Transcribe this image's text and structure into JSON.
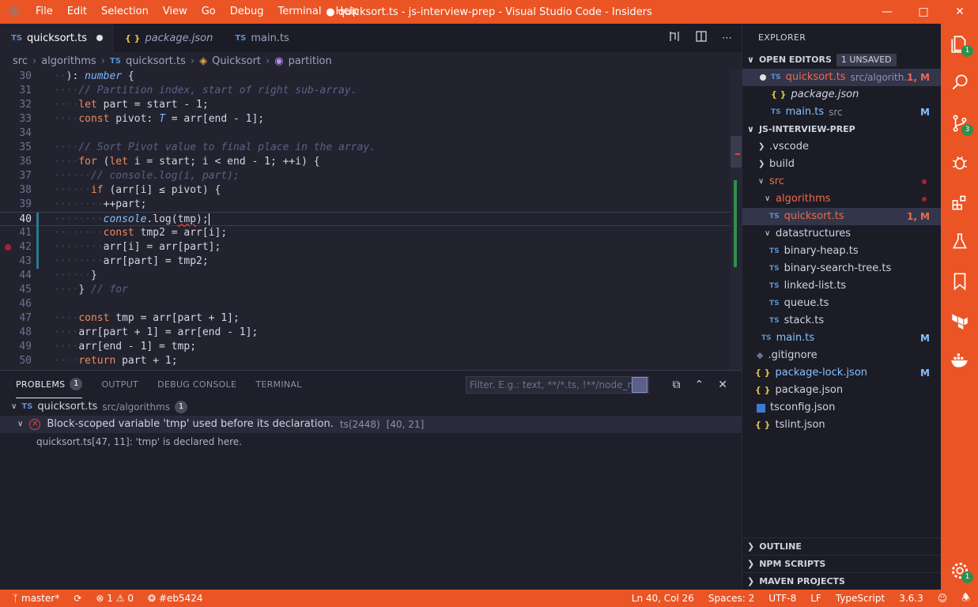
{
  "window": {
    "title": "● quicksort.ts - js-interview-prep - Visual Studio Code - Insiders",
    "menu": [
      "File",
      "Edit",
      "Selection",
      "View",
      "Go",
      "Debug",
      "Terminal",
      "Help"
    ],
    "logo": "⚛"
  },
  "tabs": [
    {
      "icon": "TS",
      "label": "quicksort.ts"
    },
    {
      "icon": "{ }",
      "label": "package.json"
    },
    {
      "icon": "TS",
      "label": "main.ts"
    }
  ],
  "breadcrumb": {
    "items": [
      "src",
      "algorithms",
      "quicksort.ts",
      "Quicksort",
      "partition"
    ]
  },
  "code": {
    "line_numbers": [
      "30",
      "31",
      "32",
      "33",
      "34",
      "35",
      "36",
      "37",
      "38",
      "39",
      "40",
      "41",
      "42",
      "43",
      "44",
      "45",
      "46",
      "47",
      "48",
      "49",
      "50"
    ],
    "lines": {
      "l30a": "): ",
      "l30b": "number",
      "l30c": " {",
      "l31": "// Partition index, start of right sub-array.",
      "l32a": "let",
      "l32b": " part = start - 1;",
      "l33a": "const",
      "l33b": " pivot: ",
      "l33c": "T",
      "l33d": " = arr[end - 1];",
      "l35": "// Sort Pivot value to final place in the array.",
      "l36a": "for",
      "l36b": " (",
      "l36c": "let",
      "l36d": " i = start; i < end - 1; ++i) {",
      "l37": "// console.log(i, part);",
      "l38a": "if",
      "l38b": " (arr[i] ≤ pivot) {",
      "l39": "++part;",
      "l40a": "console",
      "l40b": ".log(",
      "l40c": "tmp",
      "l40d": ");",
      "l41a": "const",
      "l41b": " tmp2 = arr[i];",
      "l42": "arr[i] = arr[part];",
      "l43": "arr[part] = tmp2;",
      "l44": "}",
      "l45a": "} ",
      "l45b": "// for",
      "l47a": "const",
      "l47b": " tmp = arr[part + 1];",
      "l48": "arr[part + 1] = arr[end - 1];",
      "l49": "arr[end - 1] = tmp;",
      "l50a": "return",
      "l50b": " part + 1;"
    }
  },
  "panel": {
    "tabs": [
      "PROBLEMS",
      "OUTPUT",
      "DEBUG CONSOLE",
      "TERMINAL"
    ],
    "problems_count": "1",
    "filter_placeholder": "Filter. E.g.: text, **/*.ts, !**/node_m...",
    "file": {
      "name": "quicksort.ts",
      "path": "src/algorithms",
      "count": "1"
    },
    "problem": {
      "message": "Block-scoped variable 'tmp' used before its declaration.",
      "code": "ts(2448)",
      "location": "[40, 21]"
    },
    "related": "quicksort.ts[47, 11]: 'tmp' is declared here."
  },
  "explorer": {
    "header": "EXPLORER",
    "open_editors": {
      "title": "OPEN EDITORS",
      "badge": "1 UNSAVED",
      "items": [
        {
          "name": "quicksort.ts",
          "path": "src/algorith...",
          "status": "1, M"
        },
        {
          "name": "package.json",
          "path": "",
          "status": ""
        },
        {
          "name": "main.ts",
          "path": "src",
          "status": "M"
        }
      ]
    },
    "project": {
      "title": "JS-INTERVIEW-PREP",
      "items": [
        ".vscode",
        "build",
        "src",
        "algorithms",
        "quicksort.ts",
        "datastructures",
        "binary-heap.ts",
        "binary-search-tree.ts",
        "linked-list.ts",
        "queue.ts",
        "stack.ts",
        "main.ts",
        ".gitignore",
        "package-lock.json",
        "package.json",
        "tsconfig.json",
        "tslint.json"
      ],
      "status_quicksort": "1, M",
      "status_main": "M",
      "status_lock": "M"
    },
    "bottom_sections": [
      "OUTLINE",
      "NPM SCRIPTS",
      "MAVEN PROJECTS"
    ]
  },
  "activity": {
    "explorer_badge": "1",
    "scm_badge": "3",
    "settings_badge": "1"
  },
  "status": {
    "branch": "master*",
    "errors": "1",
    "warnings": "0",
    "color": "#eb5424",
    "cursor": "Ln 40, Col 26",
    "spaces": "Spaces: 2",
    "encoding": "UTF-8",
    "eol": "LF",
    "language": "TypeScript",
    "version": "3.6.3"
  }
}
